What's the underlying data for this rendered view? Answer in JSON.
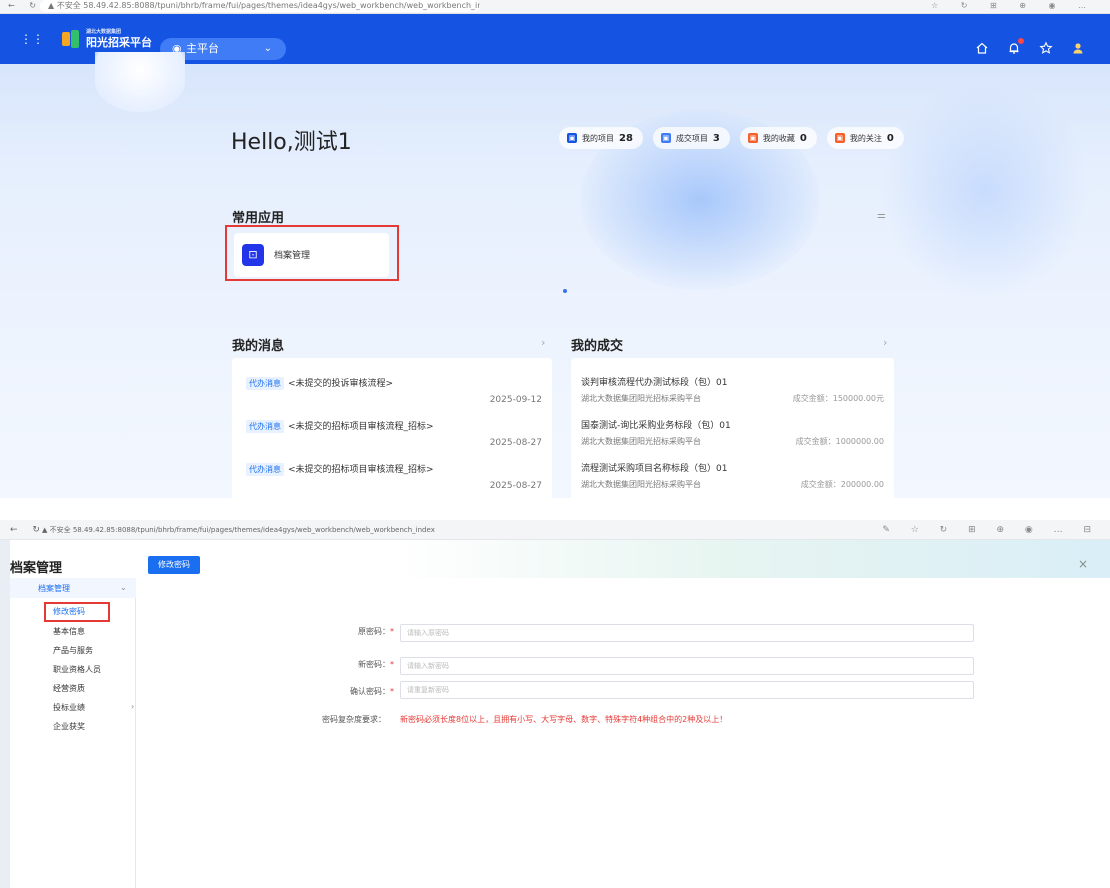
{
  "shot1": {
    "browser": {
      "nav": "← ↻",
      "url": "▲ 不安全   58.49.42.85:8088/tpuni/bhrb/frame/fui/pages/themes/idea4gys/web_workbench/web_workbench_index",
      "icons": "☆ ↻ ⊞ ⊕ ◉ …"
    },
    "appbar": {
      "grid_icon": "⋮⋮",
      "logo_small": "湖北大数据集团",
      "logo_text": "阳光招采平台",
      "platform_label": "主平台",
      "pin": "◉",
      "chevron": "⌄"
    },
    "greeting": "Hello,测试1",
    "stats": [
      {
        "label": "我的项目",
        "count": "28",
        "color": "#1554e3",
        "icon": "▣"
      },
      {
        "label": "成交项目",
        "count": "3",
        "color": "#3f7cf5",
        "icon": "▣"
      },
      {
        "label": "我的收藏",
        "count": "0",
        "color": "#f5602a",
        "icon": "▣"
      },
      {
        "label": "我的关注",
        "count": "0",
        "color": "#f5602a",
        "icon": "▣"
      }
    ],
    "common_apps": {
      "title": "常用应用",
      "tune_icon": "⚌",
      "items": [
        {
          "label": "档案管理",
          "icon": "⊡"
        }
      ]
    },
    "messages": {
      "title": "我的消息",
      "arrow": "›",
      "items": [
        {
          "tag": "代办消息",
          "text": "<未提交的投诉审核流程>",
          "date": "2025-09-12"
        },
        {
          "tag": "代办消息",
          "text": "<未提交的招标项目审核流程_招标>",
          "date": "2025-08-27"
        },
        {
          "tag": "代办消息",
          "text": "<未提交的招标项目审核流程_招标>",
          "date": "2025-08-27"
        }
      ]
    },
    "deals": {
      "title": "我的成交",
      "arrow": "›",
      "items": [
        {
          "title": "谈判审核流程代办测试标段（包）01",
          "org": "湖北大数据集团阳光招标采购平台",
          "amount": "成交金额：150000.00元"
        },
        {
          "title": "国泰测试-询比采购业务标段（包）01",
          "org": "湖北大数据集团阳光招标采购平台",
          "amount": "成交金额：1000000.00"
        },
        {
          "title": "流程测试采购项目名称标段（包）01",
          "org": "湖北大数据集团阳光招标采购平台",
          "amount": "成交金额：200000.00"
        }
      ]
    }
  },
  "shot2": {
    "browser": {
      "nav": "← ↻",
      "url": "▲ 不安全   58.49.42.85:8088/tpuni/bhrb/frame/fui/pages/themes/idea4gys/web_workbench/web_workbench_index",
      "icons": "✎ ☆ ↻ ⊞ ⊕ ◉ … ⊟"
    },
    "page_title": "档案管理",
    "close": "×",
    "sidebar": {
      "group": "档案管理",
      "group_chevron": "⌄",
      "items": [
        {
          "label": "修改密码"
        },
        {
          "label": "基本信息"
        },
        {
          "label": "产品与服务"
        },
        {
          "label": "职业资格人员"
        },
        {
          "label": "经营资质"
        },
        {
          "label": "投标业绩",
          "chevron": "›"
        },
        {
          "label": "企业获奖"
        }
      ]
    },
    "tab": "修改密码",
    "form": {
      "required_mark": "*",
      "fields": [
        {
          "label": "原密码：",
          "placeholder": "请输入原密码"
        },
        {
          "label": "新密码：",
          "placeholder": "请输入新密码"
        },
        {
          "label": "确认密码：",
          "placeholder": "请重复新密码"
        }
      ],
      "rule_label": "密码复杂度要求：",
      "rule_text": "新密码必须长度8位以上，且拥有小写、大写字母、数字、特殊字符4种组合中的2种及以上！"
    }
  }
}
